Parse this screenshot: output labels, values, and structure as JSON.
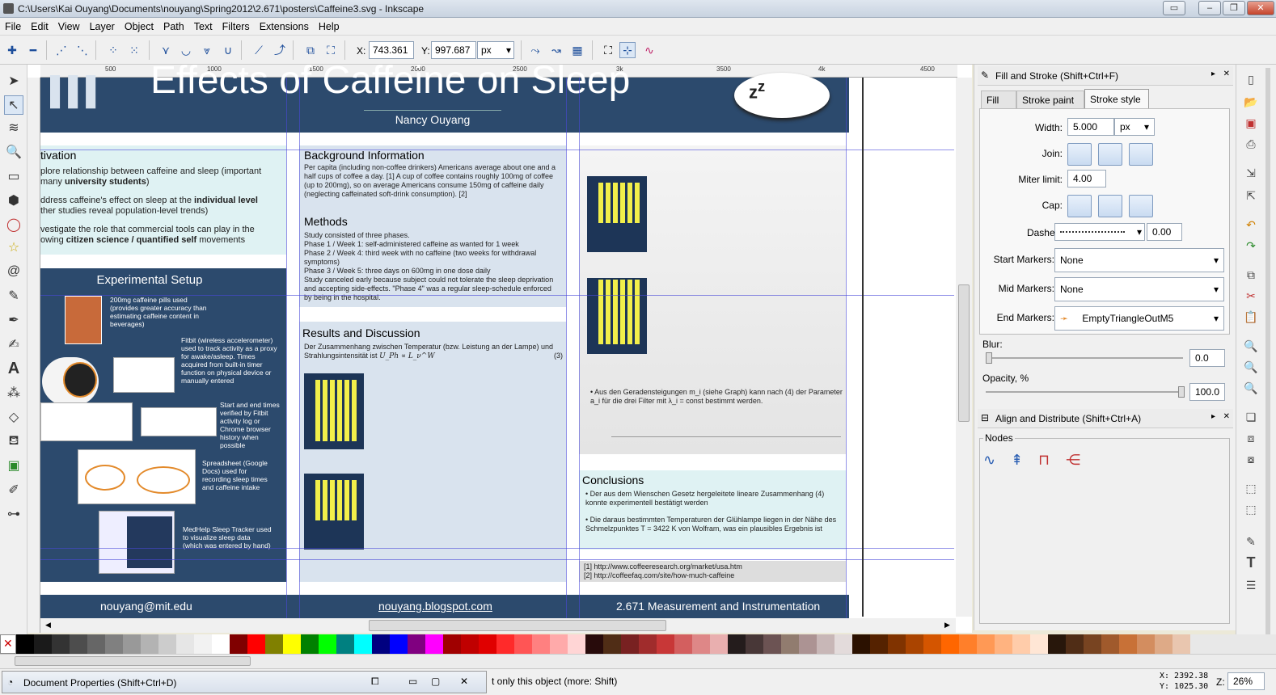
{
  "window": {
    "title": "C:\\Users\\Kai Ouyang\\Documents\\nouyang\\Spring2012\\2.671\\posters\\Caffeine3.svg - Inkscape"
  },
  "menu": [
    "File",
    "Edit",
    "View",
    "Layer",
    "Object",
    "Path",
    "Text",
    "Filters",
    "Extensions",
    "Help"
  ],
  "toolbar": {
    "x_label": "X:",
    "x_value": "743.361",
    "y_label": "Y:",
    "y_value": "997.687",
    "unit": "px"
  },
  "ruler": {
    "ticks": [
      "500",
      "1000",
      "1500",
      "2000",
      "2500",
      "3k",
      "3500",
      "4k",
      "4500"
    ]
  },
  "poster": {
    "title": "Effects of Caffeine on Sleep",
    "author": "Nancy Ouyang",
    "motivation": {
      "title": "tivation",
      "items": [
        {
          "pre": "plore relationship between caffeine and sleep (important",
          "line2": "many ",
          "bold": "university students",
          "post": ")"
        },
        {
          "pre": "ddress caffeine's effect on sleep at the ",
          "bold": "individual level",
          "line2": "ther studies reveal population-level trends)"
        },
        {
          "pre": "vestigate the role that commercial tools can play in the",
          "line2": "owing ",
          "bold": "citizen science / quantified self",
          "post": " movements"
        }
      ]
    },
    "setup": {
      "title": "Experimental Setup",
      "items": [
        "200mg caffeine pills used (provides greater accuracy than estimating caffeine content in beverages)",
        "Fitbit (wireless accelerometer) used to track activity as a proxy for awake/asleep. Times acquired from built-in timer function on physical device or manually entered",
        "Start and end times verified by Fitbit activity log or Chrome browser history when possible",
        "Spreadsheet (Google Docs) used for recording sleep times and caffeine intake",
        "MedHelp Sleep Tracker used to visualize sleep data (which was entered by hand)"
      ]
    },
    "background": {
      "title": "Background Information",
      "text": "Per capita (including non-coffee drinkers) Americans average about one and a half cups of coffee a day. [1] A cup of coffee contains roughly 100mg of coffee (up to 200mg), so on average Americans consume 150mg of caffeine daily (neglecting caffeinated soft-drink consumption). [2]"
    },
    "methods": {
      "title": "Methods",
      "lines": [
        "Study consisted of three phases.",
        "Phase 1 / Week 1: self-administered caffeine as wanted for 1 week",
        "Phase 2 / Week 4: third week with no caffeine (two weeks for withdrawal symptoms)",
        "Phase 3 / Week 5: three days on 600mg in one dose daily",
        "Study canceled early because subject could not tolerate the sleep deprivation and accepting side-effects. \"Phase 4\" was a regular sleep-schedule enforced by being in the hospital."
      ]
    },
    "results": {
      "title": "Results and Discussion",
      "text": "Der Zusammenhang zwischen Temperatur (bzw. Leistung an der Lampe) und Strahlungsintensität ist",
      "formula": "U_Ph ∝ L_ν^W",
      "eqnum": "(3)"
    },
    "right_bullet": "Aus den Geradensteigungen m_i (siehe Graph) kann nach (4) der Parameter a_i für die drei Filter mit λ_i = const bestimmt werden.",
    "conclusions": {
      "title": "Conclusions",
      "items": [
        "Der aus dem Wienschen Gesetz hergeleitete lineare Zusammenhang (4) konnte experimentell bestätigt werden",
        "Die daraus bestimmten Temperaturen der Glühlampe liegen in der Nähe des Schmelzpunktes T = 3422 K von Wolfram, was ein plausibles Ergebnis ist"
      ]
    },
    "refs": [
      "[1] http://www.coffeeresearch.org/market/usa.htm",
      "[2] http://coffeefaq.com/site/how-much-caffeine"
    ],
    "footer": {
      "email": "nouyang@mit.edu",
      "blog": "nouyang.blogspot.com",
      "course": "2.671 Measurement and Instrumentation"
    }
  },
  "fill_stroke": {
    "title": "Fill and Stroke (Shift+Ctrl+F)",
    "tabs": [
      "Fill",
      "Stroke paint",
      "Stroke style"
    ],
    "width_label": "Width:",
    "width_value": "5.000",
    "width_unit": "px",
    "join_label": "Join:",
    "miter_label": "Miter limit:",
    "miter_value": "4.00",
    "cap_label": "Cap:",
    "dashes_label": "Dashes:",
    "dash_offset": "0.00",
    "start_markers_label": "Start Markers:",
    "start_markers_value": "None",
    "mid_markers_label": "Mid Markers:",
    "mid_markers_value": "None",
    "end_markers_label": "End Markers:",
    "end_markers_value": "EmptyTriangleOutM5",
    "blur_label": "Blur:",
    "blur_value": "0.0",
    "opacity_label": "Opacity, %",
    "opacity_value": "100.0"
  },
  "align": {
    "title": "Align and Distribute (Shift+Ctrl+A)",
    "nodes_label": "Nodes"
  },
  "status": {
    "doc_props": "Document Properties (Shift+Ctrl+D)",
    "message": "t only this object (more: Shift)",
    "x": "X: 2392.38",
    "y": "Y: 1025.30",
    "zoom_label": "Z:",
    "zoom": "26%"
  },
  "palette_colors": [
    "#000000",
    "#1a1a1a",
    "#333333",
    "#4d4d4d",
    "#666666",
    "#808080",
    "#999999",
    "#b3b3b3",
    "#cccccc",
    "#e6e6e6",
    "#f2f2f2",
    "#ffffff",
    "#800000",
    "#ff0000",
    "#808000",
    "#ffff00",
    "#008000",
    "#00ff00",
    "#008080",
    "#00ffff",
    "#000080",
    "#0000ff",
    "#800080",
    "#ff00ff",
    "#a00000",
    "#c00000",
    "#e00000",
    "#ff2a2a",
    "#ff5555",
    "#ff8080",
    "#ffaaaa",
    "#ffd5d5",
    "#280b0b",
    "#502d16",
    "#782121",
    "#a02c2c",
    "#c83737",
    "#d35f5f",
    "#de8787",
    "#e9afaf",
    "#241c1c",
    "#483737",
    "#6c5353",
    "#917c6f",
    "#ac9393",
    "#c8b7b7",
    "#e3dbdb",
    "#2b1100",
    "#552200",
    "#803300",
    "#aa4400",
    "#d45500",
    "#ff6600",
    "#ff7f2a",
    "#ff9955",
    "#ffb380",
    "#ffccaa",
    "#ffe6d5",
    "#28170b",
    "#502d16",
    "#784421",
    "#a05a2c",
    "#c87137",
    "#d38d5f",
    "#deaa87",
    "#e9c6af"
  ]
}
